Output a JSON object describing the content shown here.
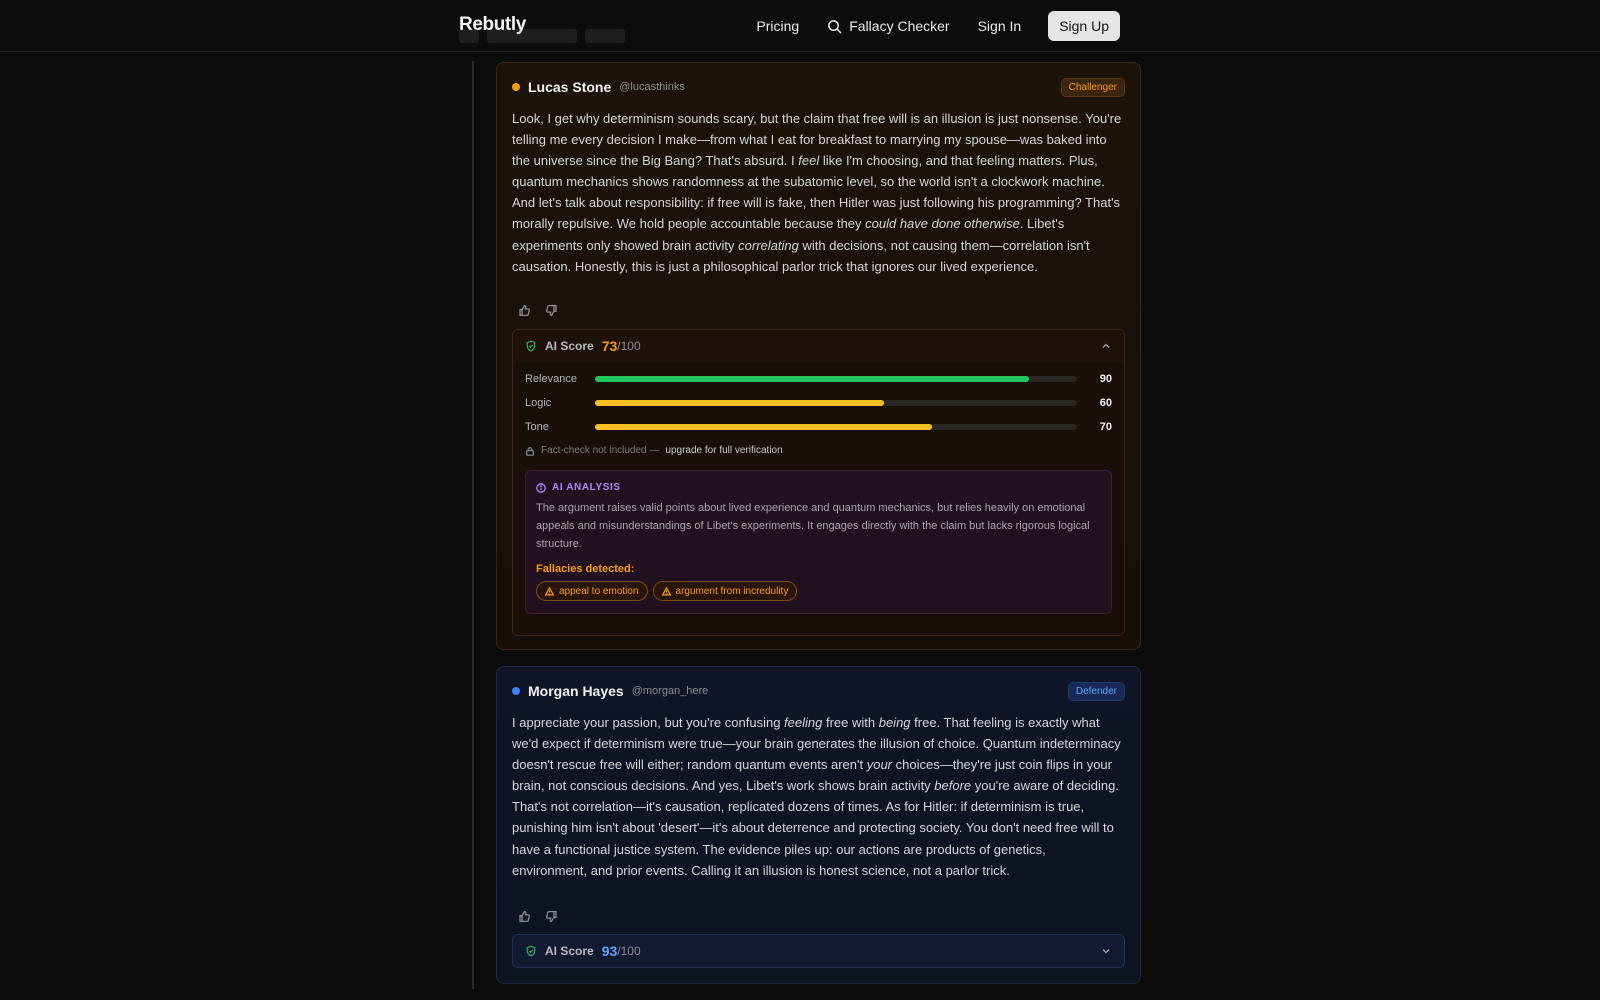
{
  "header": {
    "brand": "Rebutly",
    "nav": {
      "pricing": "Pricing",
      "fallacy_checker": "Fallacy Checker",
      "sign_in": "Sign In",
      "sign_up": "Sign Up"
    }
  },
  "posts": [
    {
      "author": "Lucas Stone",
      "handle": "@lucasthinks",
      "role": "Challenger",
      "accent": "#f59e0b",
      "body_html": "Look, I get why determinism sounds scary, but the claim that free will is an illusion is just nonsense. You're telling me every decision I make—from what I eat for breakfast to marrying my spouse—was baked into the universe since the Big Bang? That's absurd. I <em>feel</em> like I'm choosing, and that feeling matters. Plus, quantum mechanics shows randomness at the subatomic level, so the world isn't a clockwork machine. And let's talk about responsibility: if free will is fake, then Hitler was just following his programming? That's morally repulsive. We hold people accountable because they <em>could have done otherwise</em>. Libet's experiments only showed brain activity <em>correlating</em> with decisions, not causing them—correlation isn't causation. Honestly, this is just a philosophical parlor trick that ignores our lived experience.",
      "ai_score": {
        "label": "AI Score",
        "value": "73",
        "max": "/100",
        "expanded": true,
        "metrics": [
          {
            "label": "Relevance",
            "value": 90,
            "display": "90",
            "color": "#22c55e"
          },
          {
            "label": "Logic",
            "value": 60,
            "display": "60",
            "color": "#fbbf24"
          },
          {
            "label": "Tone",
            "value": 70,
            "display": "70",
            "color": "#fbbf24"
          }
        ],
        "factcheck_note": "Fact-check not included —",
        "factcheck_upgrade": "upgrade for full verification",
        "analysis_title": "AI ANALYSIS",
        "analysis_text": "The argument raises valid points about lived experience and quantum mechanics, but relies heavily on emotional appeals and misunderstandings of Libet's experiments. It engages directly with the claim but lacks rigorous logical structure.",
        "fallacies_title": "Fallacies detected:",
        "fallacies": [
          "appeal to emotion",
          "argument from incredulity"
        ]
      }
    },
    {
      "author": "Morgan Hayes",
      "handle": "@morgan_here",
      "role": "Defender",
      "accent": "#3b82f6",
      "body_html": "I appreciate your passion, but you're confusing <em>feeling</em> free with <em>being</em> free. That feeling is exactly what we'd expect if determinism were true—your brain generates the illusion of choice. Quantum indeterminacy doesn't rescue free will either; random quantum events aren't <em>your</em> choices—they're just coin flips in your brain, not conscious decisions. And yes, Libet's work shows brain activity <em>before</em> you're aware of deciding. That's not correlation—it's causation, replicated dozens of times. As for Hitler: if determinism is true, punishing him isn't about 'desert'—it's about deterrence and protecting society. You don't need free will to have a functional justice system. The evidence piles up: our actions are products of genetics, environment, and prior events. Calling it an illusion is honest science, not a parlor trick.",
      "ai_score": {
        "label": "AI Score",
        "value": "93",
        "max": "/100",
        "expanded": false
      }
    }
  ]
}
